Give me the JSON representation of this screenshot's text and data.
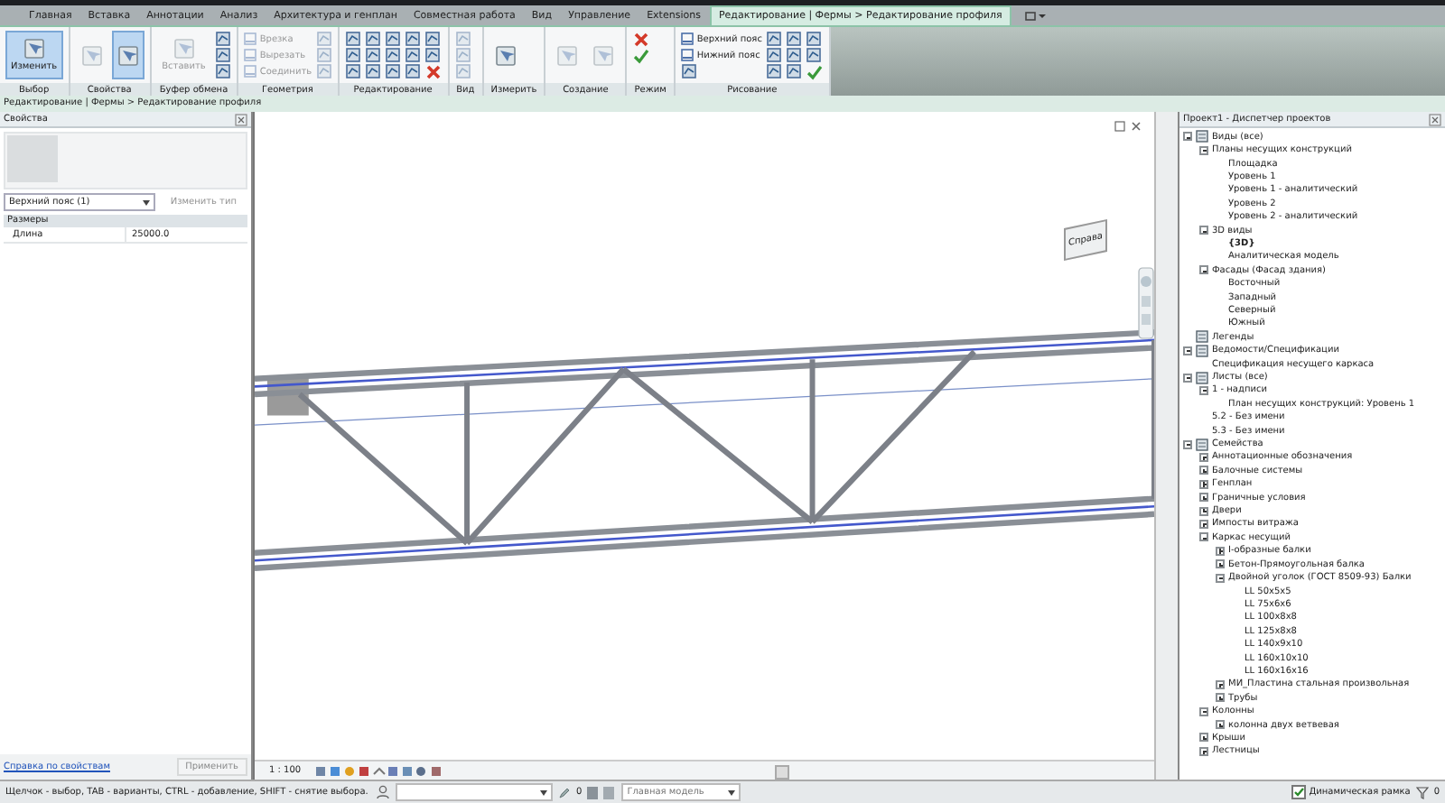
{
  "tabs": [
    {
      "label": "Главная",
      "selected": false
    },
    {
      "label": "Вставка",
      "selected": false
    },
    {
      "label": "Аннотации",
      "selected": false
    },
    {
      "label": "Анализ",
      "selected": false
    },
    {
      "label": "Архитектура и генплан",
      "selected": false
    },
    {
      "label": "Совместная работа",
      "selected": false
    },
    {
      "label": "Вид",
      "selected": false
    },
    {
      "label": "Управление",
      "selected": false
    },
    {
      "label": "Extensions",
      "selected": false
    },
    {
      "label": "Редактирование | Фермы > Редактирование профиля",
      "selected": true
    }
  ],
  "ribbon": [
    {
      "label": "Выбор",
      "tools": [
        {
          "kind": "large",
          "label": "Изменить",
          "selected": true,
          "disabled": false
        }
      ]
    },
    {
      "label": "Свойства",
      "tools": [
        {
          "kind": "large",
          "selected": false,
          "disabled": true
        },
        {
          "kind": "large",
          "selected": true,
          "disabled": false
        }
      ]
    },
    {
      "label": "Буфер обмена",
      "tools": [
        {
          "kind": "large",
          "label": "Вставить",
          "selected": false,
          "disabled": true
        },
        {
          "kind": "icon",
          "selected": false,
          "disabled": false
        },
        {
          "kind": "icon",
          "selected": false,
          "disabled": false
        },
        {
          "kind": "icon",
          "selected": false,
          "disabled": false
        }
      ]
    },
    {
      "label": "Геометрия",
      "tools": [
        {
          "kind": "small",
          "label": "Врезка",
          "selected": false,
          "disabled": true
        },
        {
          "kind": "small",
          "label": "Вырезать",
          "selected": false,
          "disabled": true
        },
        {
          "kind": "small",
          "label": "Соединить",
          "selected": false,
          "disabled": true
        },
        {
          "kind": "icon",
          "selected": false,
          "disabled": true
        },
        {
          "kind": "icon",
          "selected": false,
          "disabled": true
        },
        {
          "kind": "icon",
          "selected": false,
          "disabled": true
        }
      ]
    },
    {
      "label": "Редактирование",
      "tools": [
        {
          "kind": "icon",
          "selected": false,
          "disabled": false
        },
        {
          "kind": "icon",
          "selected": false,
          "disabled": false
        },
        {
          "kind": "icon",
          "selected": false,
          "disabled": false
        },
        {
          "kind": "icon",
          "selected": false,
          "disabled": false
        },
        {
          "kind": "icon",
          "selected": false,
          "disabled": false
        },
        {
          "kind": "icon",
          "selected": false,
          "disabled": false
        },
        {
          "kind": "icon",
          "selected": false,
          "disabled": false
        },
        {
          "kind": "icon",
          "selected": false,
          "disabled": false
        },
        {
          "kind": "icon",
          "selected": false,
          "disabled": false
        },
        {
          "kind": "icon",
          "selected": false,
          "disabled": false
        },
        {
          "kind": "icon",
          "selected": false,
          "disabled": false
        },
        {
          "kind": "icon",
          "selected": false,
          "disabled": false
        },
        {
          "kind": "icon",
          "selected": false,
          "disabled": false
        },
        {
          "kind": "icon",
          "selected": false,
          "disabled": false
        },
        {
          "kind": "cross",
          "selected": false,
          "disabled": false
        }
      ]
    },
    {
      "label": "Вид",
      "tools": [
        {
          "kind": "icon",
          "selected": false,
          "disabled": true
        },
        {
          "kind": "icon",
          "selected": false,
          "disabled": true
        },
        {
          "kind": "icon",
          "selected": false,
          "disabled": true
        }
      ]
    },
    {
      "label": "Измерить",
      "tools": [
        {
          "kind": "large",
          "selected": false,
          "disabled": false
        }
      ]
    },
    {
      "label": "Создание",
      "tools": [
        {
          "kind": "large",
          "selected": false,
          "disabled": true
        },
        {
          "kind": "large",
          "selected": false,
          "disabled": true
        }
      ]
    },
    {
      "label": "Режим",
      "tools": [
        {
          "kind": "cross",
          "selected": false,
          "disabled": false
        },
        {
          "kind": "check",
          "selected": false,
          "disabled": false
        }
      ]
    },
    {
      "label": "Рисование",
      "tools": [
        {
          "kind": "small",
          "label": "Верхний пояс",
          "selected": false,
          "disabled": false
        },
        {
          "kind": "small",
          "label": "Нижний пояс",
          "selected": false,
          "disabled": false
        },
        {
          "kind": "icon",
          "selected": false,
          "disabled": false
        },
        {
          "kind": "icon",
          "selected": false,
          "disabled": false
        },
        {
          "kind": "icon",
          "selected": false,
          "disabled": false
        },
        {
          "kind": "icon",
          "selected": false,
          "disabled": false
        },
        {
          "kind": "icon",
          "selected": false,
          "disabled": false
        },
        {
          "kind": "icon",
          "selected": false,
          "disabled": false
        },
        {
          "kind": "icon",
          "selected": false,
          "disabled": false
        },
        {
          "kind": "icon",
          "selected": false,
          "disabled": false
        },
        {
          "kind": "icon",
          "selected": false,
          "disabled": false
        },
        {
          "kind": "check",
          "selected": false,
          "disabled": false
        }
      ]
    }
  ],
  "breadcrumb": "Редактирование | Фермы > Редактирование профиля",
  "properties": {
    "title": "Свойства",
    "type_selector": "Верхний пояс (1)",
    "edit_type": {
      "label": "Изменить тип",
      "disabled": true
    },
    "groups": [
      {
        "label": "Размеры",
        "rows": [
          {
            "name": "Длина",
            "value": "25000.0"
          }
        ]
      }
    ],
    "help_link": "Справка по свойствам",
    "apply": {
      "label": "Применить",
      "disabled": true
    }
  },
  "viewport": {
    "viewcube_label": "Справа",
    "scale": "1 : 100"
  },
  "project_browser": {
    "title": "Проект1 - Диспетчер проектов",
    "tree": [
      {
        "label": "Виды (все)",
        "expanded": true,
        "children": [
          {
            "label": "Планы несущих конструкций",
            "expanded": true,
            "children": [
              {
                "label": "Площадка"
              },
              {
                "label": "Уровень 1"
              },
              {
                "label": "Уровень 1 - аналитический"
              },
              {
                "label": "Уровень 2"
              },
              {
                "label": "Уровень 2 - аналитический"
              }
            ]
          },
          {
            "label": "3D виды",
            "expanded": true,
            "children": [
              {
                "label": "{3D}",
                "active": true
              },
              {
                "label": "Аналитическая модель",
                "active": false
              }
            ]
          },
          {
            "label": "Фасады (Фасад здания)",
            "expanded": true,
            "children": [
              {
                "label": "Восточный"
              },
              {
                "label": "Западный"
              },
              {
                "label": "Северный"
              },
              {
                "label": "Южный"
              }
            ]
          }
        ]
      },
      {
        "label": "Легенды"
      },
      {
        "label": "Ведомости/Спецификации",
        "expanded": true,
        "children": [
          {
            "label": "Спецификация несущего каркаса"
          }
        ]
      },
      {
        "label": "Листы (все)",
        "expanded": true,
        "children": [
          {
            "label": "1 - надписи",
            "expanded": true,
            "children": [
              {
                "label": "План несущих конструкций: Уровень 1"
              }
            ]
          },
          {
            "label": "5.2 - Без имени"
          },
          {
            "label": "5.3 - Без имени"
          }
        ]
      },
      {
        "label": "Семейства",
        "expanded": true,
        "children": [
          {
            "label": "Аннотационные обозначения",
            "expanded": false
          },
          {
            "label": "Балочные системы",
            "expanded": false
          },
          {
            "label": "Генплан",
            "expanded": false
          },
          {
            "label": "Граничные условия",
            "expanded": false
          },
          {
            "label": "Двери",
            "expanded": false
          },
          {
            "label": "Импосты витража",
            "expanded": false
          },
          {
            "label": "Каркас несущий",
            "expanded": true,
            "children": [
              {
                "label": "I-образные балки",
                "expanded": false
              },
              {
                "label": "Бетон-Прямоугольная балка",
                "expanded": false
              },
              {
                "label": "Двойной уголок (ГОСТ 8509-93) Балки",
                "expanded": true,
                "children": [
                  {
                    "label": "LL 50x5x5"
                  },
                  {
                    "label": "LL 75x6x6"
                  },
                  {
                    "label": "LL 100x8x8"
                  },
                  {
                    "label": "LL 125x8x8"
                  },
                  {
                    "label": "LL 140x9x10"
                  },
                  {
                    "label": "LL 160x10x10"
                  },
                  {
                    "label": "LL 160x16x16"
                  }
                ]
              },
              {
                "label": "МИ_Пластина стальная произвольная",
                "expanded": false
              },
              {
                "label": "Трубы",
                "expanded": false
              }
            ]
          },
          {
            "label": "Колонны",
            "expanded": true,
            "children": [
              {
                "label": "колонна двух ветвевая",
                "expanded": false
              }
            ]
          },
          {
            "label": "Крыши",
            "expanded": false
          },
          {
            "label": "Лестницы",
            "expanded": false
          }
        ]
      }
    ]
  },
  "status_bar": {
    "hint": "Щелчок - выбор, TAB - варианты, CTRL - добавление, SHIFT - снятие выбора.",
    "workset_count": "0",
    "model": "Главная модель",
    "dynamic_frame": {
      "label": "Динамическая рамка",
      "checked": true
    },
    "filter_count": "0"
  }
}
